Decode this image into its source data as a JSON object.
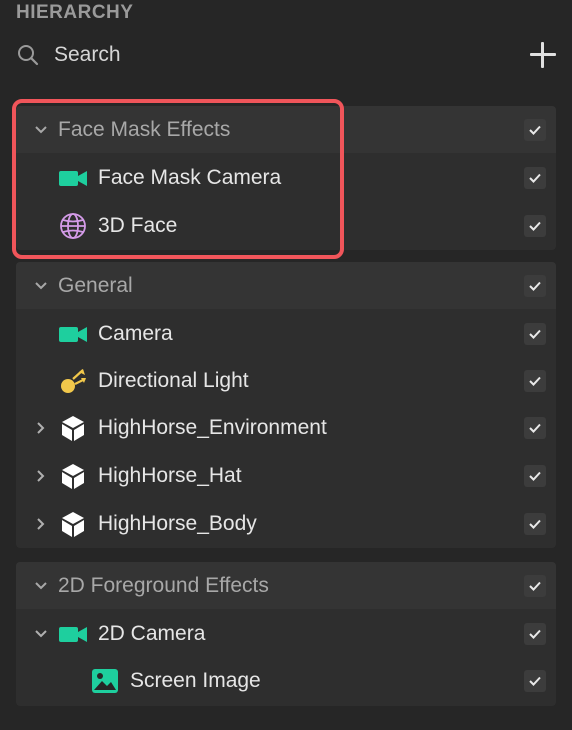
{
  "panel": {
    "title": "HIERARCHY"
  },
  "search": {
    "label": "Search"
  },
  "colors": {
    "accent_camera": "#1ecf9e",
    "accent_face": "#d49be8",
    "accent_light": "#f2c84b",
    "highlight": "#f0555a",
    "background": "#262626"
  },
  "groups": [
    {
      "header": "Face Mask Effects",
      "items": [
        {
          "label": "Face Mask Camera",
          "icon": "camera-icon",
          "checked": true
        },
        {
          "label": "3D Face",
          "icon": "face-mesh-icon",
          "checked": true
        }
      ]
    },
    {
      "header": "General",
      "items": [
        {
          "label": "Camera",
          "icon": "camera-icon",
          "checked": true
        },
        {
          "label": "Directional Light",
          "icon": "directional-light-icon",
          "checked": true
        },
        {
          "label": "HighHorse_Environment",
          "icon": "cube-icon",
          "checked": true,
          "collapsed": true
        },
        {
          "label": "HighHorse_Hat",
          "icon": "cube-icon",
          "checked": true,
          "collapsed": true
        },
        {
          "label": "HighHorse_Body",
          "icon": "cube-icon",
          "checked": true,
          "collapsed": true
        }
      ]
    },
    {
      "header": "2D Foreground Effects",
      "items": [
        {
          "label": "2D Camera",
          "icon": "camera-icon",
          "checked": true,
          "expanded": true
        },
        {
          "label": "Screen Image",
          "icon": "image-icon",
          "checked": true
        }
      ]
    }
  ]
}
